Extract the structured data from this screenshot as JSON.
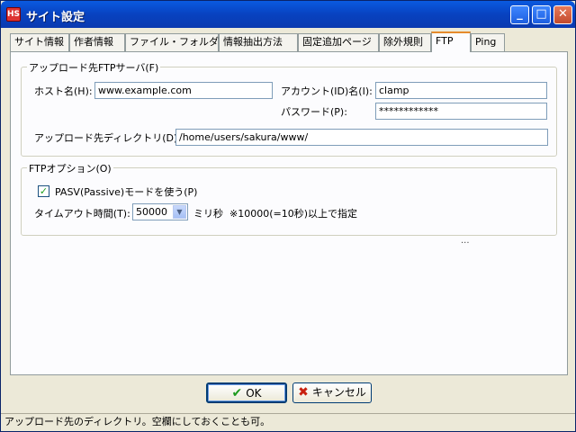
{
  "window": {
    "title": "サイト設定",
    "app_icon_text": "HS"
  },
  "tabs": [
    {
      "label": "サイト情報"
    },
    {
      "label": "作者情報"
    },
    {
      "label": "ファイル・フォルダ"
    },
    {
      "label": "情報抽出方法"
    },
    {
      "label": "固定追加ページ"
    },
    {
      "label": "除外規則"
    },
    {
      "label": "FTP"
    },
    {
      "label": "Ping"
    }
  ],
  "upload_group": {
    "title": "アップロード先FTPサーバ(F)",
    "host_label": "ホスト名(H):",
    "host_value": "www.example.com",
    "account_label": "アカウント(ID)名(I):",
    "account_value": "clamp",
    "password_label": "パスワード(P):",
    "password_value": "************",
    "dir_label": "アップロード先ディレクトリ(D):",
    "dir_value": "/home/users/sakura/www/"
  },
  "ftp_options": {
    "title": "FTPオプション(O)",
    "pasv_label": "PASV(Passive)モードを使う(P)",
    "pasv_check": "✓",
    "timeout_label": "タイムアウト時間(T):",
    "timeout_value": "50000",
    "timeout_unit": "ミリ秒",
    "timeout_note": "※10000(=10秒)以上で指定"
  },
  "extra": {
    "dots": "..."
  },
  "buttons": {
    "ok_label": "OK",
    "cancel_label": "キャンセル"
  },
  "statusbar": {
    "text": "アップロード先のディレクトリ。空欄にしておくことも可。"
  }
}
